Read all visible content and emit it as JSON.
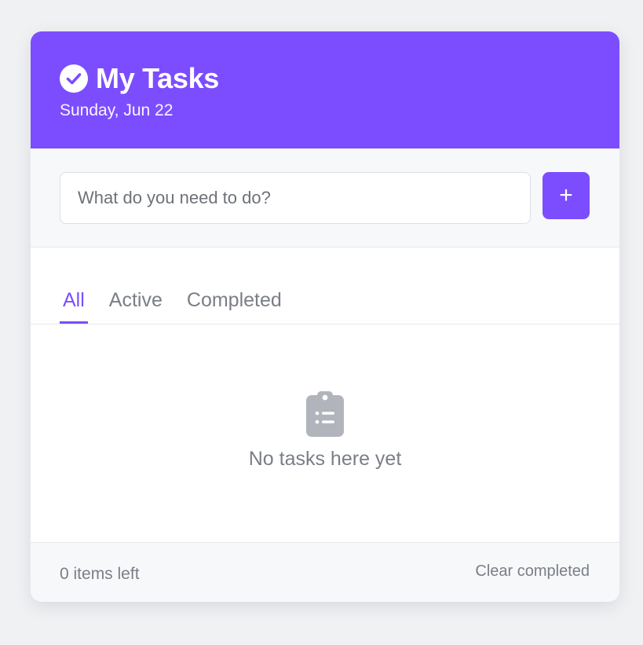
{
  "header": {
    "icon": "check-circle-icon",
    "title": "My Tasks",
    "date": "Sunday, Jun 22"
  },
  "add_task": {
    "placeholder": "What do you need to do?",
    "value": "",
    "add_label": "+"
  },
  "tabs": [
    {
      "label": "All",
      "active": true
    },
    {
      "label": "Active",
      "active": false
    },
    {
      "label": "Completed",
      "active": false
    }
  ],
  "empty_state": {
    "icon": "clipboard-list-icon",
    "message": "No tasks here yet"
  },
  "footer": {
    "items_left": "0 items left",
    "clear_label": "Clear completed"
  },
  "colors": {
    "accent": "#7c4dff",
    "background": "#f0f1f3",
    "muted_text": "#7a7e86",
    "icon_gray": "#b1b4ba"
  }
}
